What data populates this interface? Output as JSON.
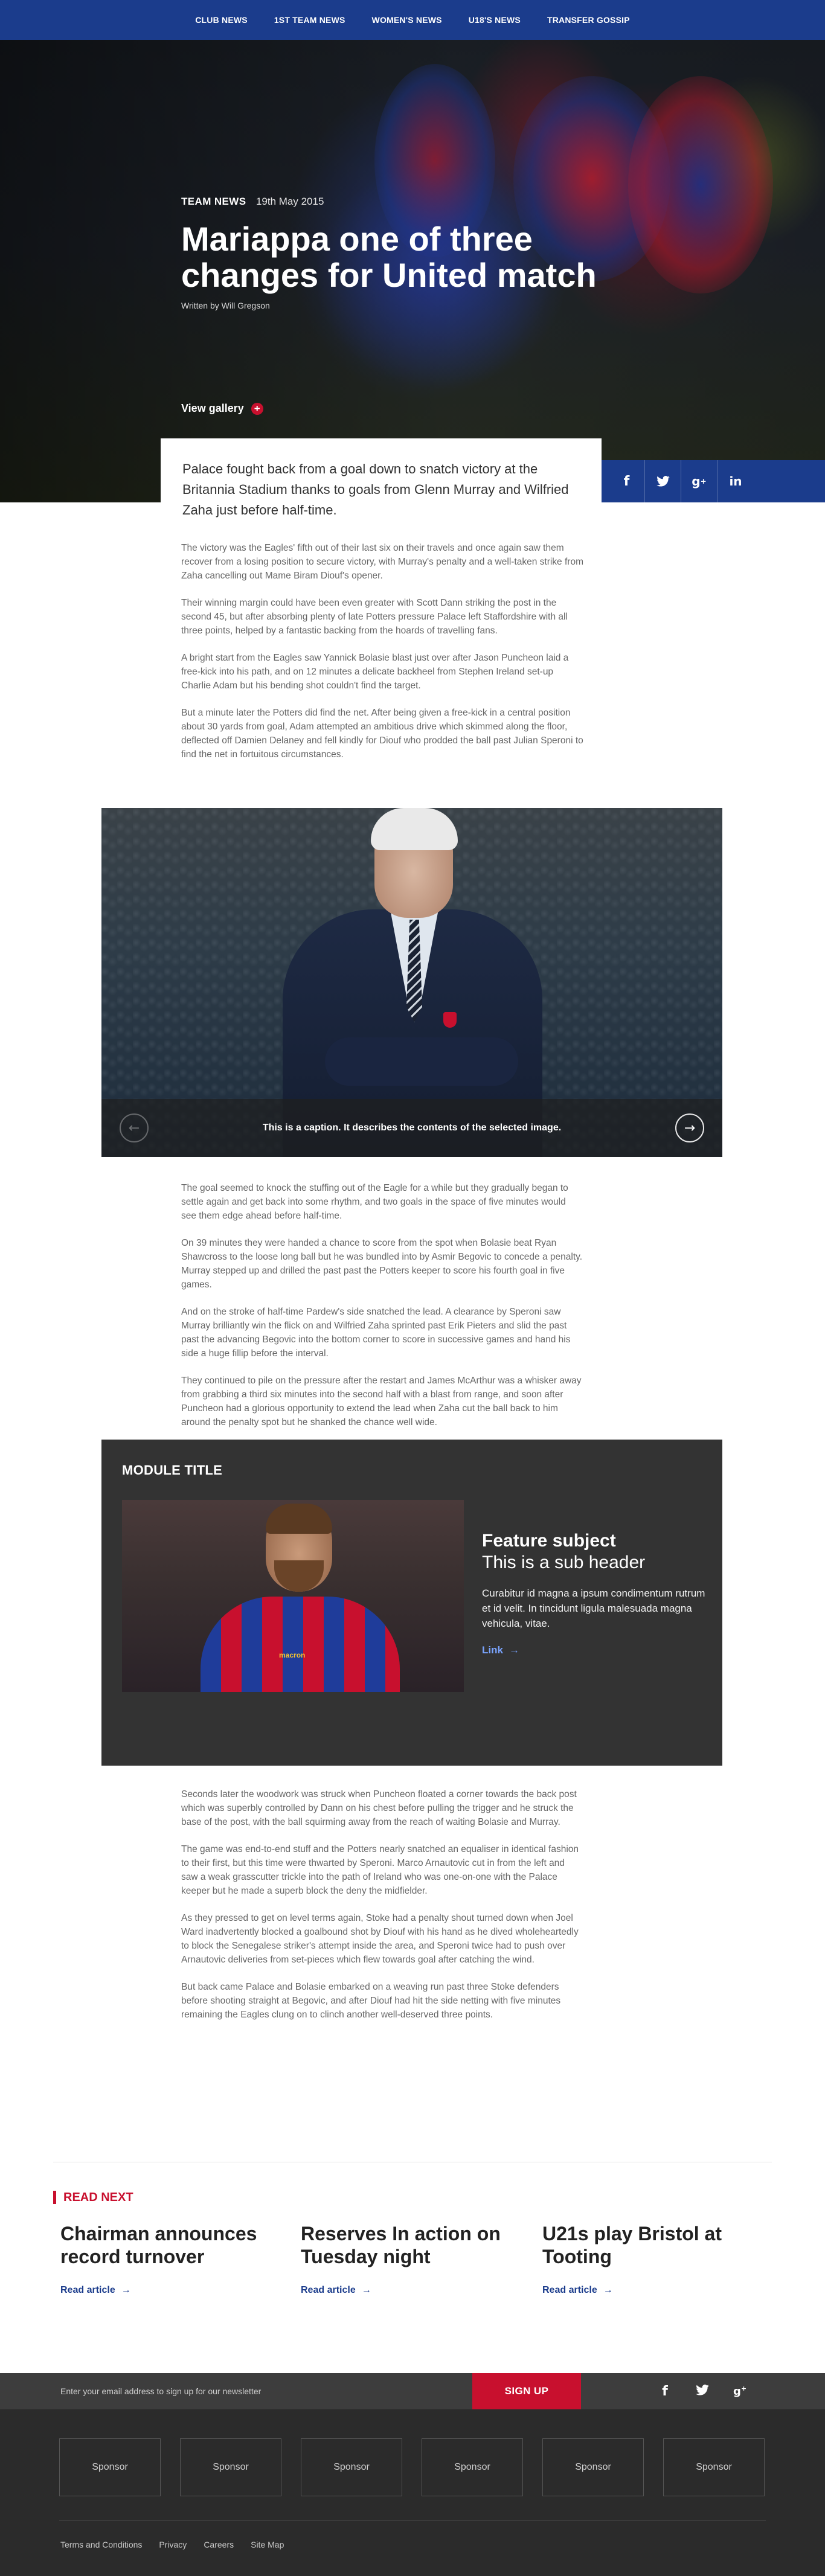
{
  "nav": {
    "items": [
      "CLUB NEWS",
      "1ST TEAM NEWS",
      "WOMEN'S NEWS",
      "U18'S NEWS",
      "TRANSFER GOSSIP"
    ]
  },
  "hero": {
    "tag": "TEAM NEWS",
    "date": "19th May 2015",
    "title": "Mariappa one of three changes for United match",
    "byline": "Written by Will Gregson",
    "gallery_label": "View gallery",
    "gallery_icon": "plus-icon"
  },
  "social": {
    "icons": [
      {
        "name": "facebook-icon",
        "glyph": "f"
      },
      {
        "name": "twitter-icon",
        "glyph": "❁"
      },
      {
        "name": "google-plus-icon",
        "glyph": "g+"
      },
      {
        "name": "linkedin-icon",
        "glyph": "in"
      }
    ]
  },
  "article": {
    "intro": "Palace fought back from a goal down to snatch victory at the Britannia Stadium thanks to goals from Glenn Murray and Wilfried Zaha just before half-time.",
    "paragraphs_a": [
      "The victory was the Eagles' fifth out of their last six on their travels and once again saw them recover from a losing position to secure victory, with Murray's penalty and a well-taken strike from Zaha cancelling out Mame Biram Diouf's opener.",
      "Their winning margin could have been even greater with Scott Dann striking the post in the second 45, but after absorbing plenty of late Potters pressure Palace left Staffordshire with all three points, helped by a fantastic backing from the hoards of travelling fans.",
      "A bright start from the Eagles saw Yannick Bolasie blast just over after Jason Puncheon laid a free-kick into his path, and on 12 minutes a delicate backheel from Stephen Ireland set-up Charlie Adam but his bending shot couldn't find the target.",
      "But a minute later the Potters did find the net. After being given a free-kick in a central position about 30 yards from goal, Adam attempted an ambitious drive which skimmed along the floor, deflected off Damien Delaney and fell kindly for Diouf who prodded the ball past Julian Speroni to find the net in fortuitous circumstances."
    ],
    "paragraphs_b": [
      "The goal seemed to knock the stuffing out of the Eagle for a while but they gradually began to settle again and get back into some rhythm, and two goals in the space of five minutes would see them edge ahead before half-time.",
      "On 39 minutes they were handed a chance to score from the spot when Bolasie beat Ryan Shawcross to the loose long ball but he was bundled into by Asmir Begovic to concede a penalty. Murray stepped up and drilled the past past the Potters keeper to score his fourth goal in five games.",
      "And on the stroke of half-time Pardew's side snatched the lead. A clearance by Speroni saw Murray brilliantly win the flick on and Wilfried Zaha sprinted past Erik Pieters and slid the past past the advancing Begovic into the bottom corner to score in successive games and hand his side a huge fillip before the interval.",
      "They continued to pile on the pressure after the restart and James McArthur was a whisker away from grabbing a third six minutes into the second half with a blast from range, and soon after Puncheon had a glorious opportunity to extend the lead when Zaha cut the ball back to him around the penalty spot but he shanked the chance well wide."
    ],
    "paragraphs_c": [
      "Seconds later the woodwork was struck when Puncheon floated a corner towards the back post which was superbly controlled by Dann on his chest before pulling the trigger and he struck the base of the post, with the ball squirming away from the reach of waiting Bolasie and Murray.",
      "The game was end-to-end stuff and the Potters nearly snatched an equaliser in identical fashion to their first, but this time were thwarted by Speroni. Marco Arnautovic cut in from the left and saw a weak grasscutter trickle into the path of Ireland who was one-on-one with the Palace keeper but he made a superb block the deny the midfielder.",
      "As they pressed to get on level terms again, Stoke had a penalty shout turned down when Joel Ward inadvertently blocked a goalbound shot by Diouf with his hand as he dived wholeheartedly to block the Senegalese striker's attempt inside the area, and Speroni twice had to push over Arnautovic deliveries from set-pieces which flew towards goal after catching the wind.",
      "But back came Palace and Bolasie embarked on a weaving run past three Stoke defenders before shooting straight at Begovic, and after Diouf had hit the side netting with five minutes remaining the Eagles clung on to clinch another well-deserved three points."
    ]
  },
  "figure": {
    "caption": "This is a caption. It describes the contents of the selected image.",
    "prev_icon": "arrow-left-icon",
    "next_icon": "arrow-right-icon"
  },
  "module": {
    "title": "MODULE TITLE",
    "feature_subject": "Feature subject",
    "feature_sub": "This is a sub header",
    "feature_body": "Curabitur id magna a ipsum condimentum rutrum et id velit. In tincidunt ligula malesuada magna vehicula, vitae.",
    "link_label": "Link",
    "image_sponsor": "macron"
  },
  "read_next": {
    "heading": "READ NEXT",
    "cards": [
      {
        "title": "Chairman announces record turnover",
        "link": "Read article"
      },
      {
        "title": "Reserves In action on Tuesday night",
        "link": "Read article"
      },
      {
        "title": "U21s play Bristol at Tooting",
        "link": "Read article"
      }
    ]
  },
  "newsletter": {
    "placeholder": "Enter your email address to sign up for our newsletter",
    "button": "SIGN UP"
  },
  "footer": {
    "sponsors": [
      "Sponsor",
      "Sponsor",
      "Sponsor",
      "Sponsor",
      "Sponsor",
      "Sponsor"
    ],
    "links": [
      "Terms and Conditions",
      "Privacy",
      "Careers",
      "Site Map"
    ]
  },
  "colors": {
    "brand_blue": "#1b3c8c",
    "brand_red": "#c8102e",
    "module_bg": "#333333",
    "footer_bg": "#2b2b2b"
  }
}
